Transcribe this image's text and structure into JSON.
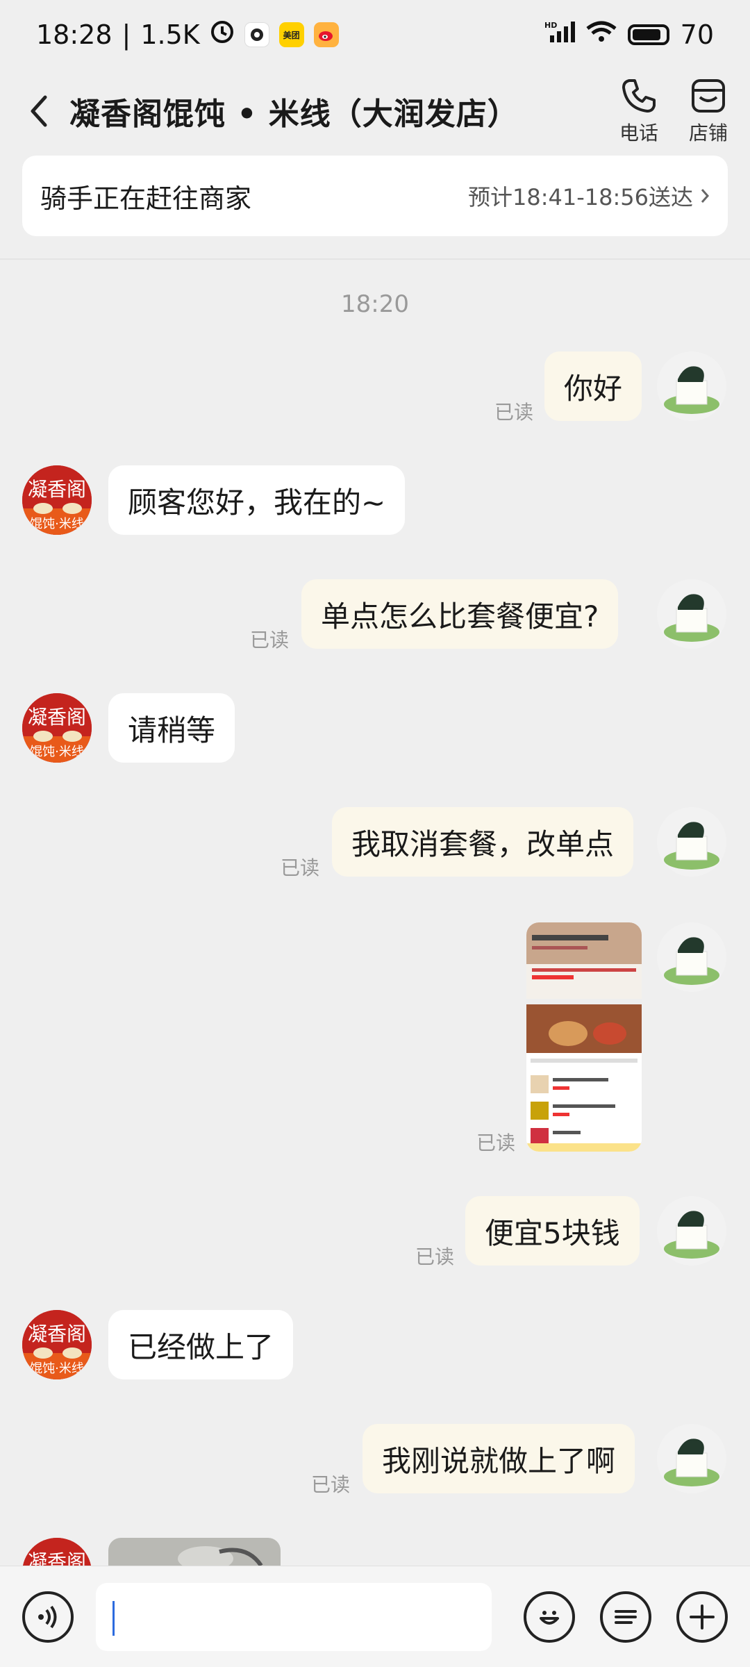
{
  "status_bar": {
    "time": "18:28",
    "net_speed": "1.5K",
    "battery": "70",
    "apps": [
      "clock-icon",
      "camera-app-icon",
      "meituan-app-icon",
      "weibo-app-icon"
    ],
    "meituan_label": "美团"
  },
  "header": {
    "title": "凝香阁馄饨 • 米线（大润发店）",
    "phone_label": "电话",
    "store_label": "店铺"
  },
  "delivery": {
    "status": "骑手正在赶往商家",
    "eta": "预计18:41-18:56送达"
  },
  "chat": {
    "timestamp": "18:20",
    "read_label": "已读",
    "messages": [
      {
        "from": "me",
        "text": "你好"
      },
      {
        "from": "shop",
        "text": "顾客您好，我在的~"
      },
      {
        "from": "me",
        "text": "单点怎么比套餐便宜?"
      },
      {
        "from": "shop",
        "text": "请稍等"
      },
      {
        "from": "me",
        "text": "我取消套餐，改单点"
      },
      {
        "from": "me",
        "type": "image"
      },
      {
        "from": "me",
        "text": "便宜5块钱"
      },
      {
        "from": "shop",
        "text": "已经做上了"
      },
      {
        "from": "me",
        "text": "我刚说就做上了啊"
      },
      {
        "from": "shop",
        "type": "image"
      }
    ]
  },
  "shop_logo": {
    "line1": "凝香阁",
    "line2": "馄饨·米线"
  },
  "input_bar": {
    "placeholder": ""
  },
  "colors": {
    "background": "#efefef",
    "outgoing_bubble": "#fbf7ea",
    "incoming_bubble": "#ffffff",
    "shop_red": "#c4241e",
    "caret": "#2c6bde"
  }
}
